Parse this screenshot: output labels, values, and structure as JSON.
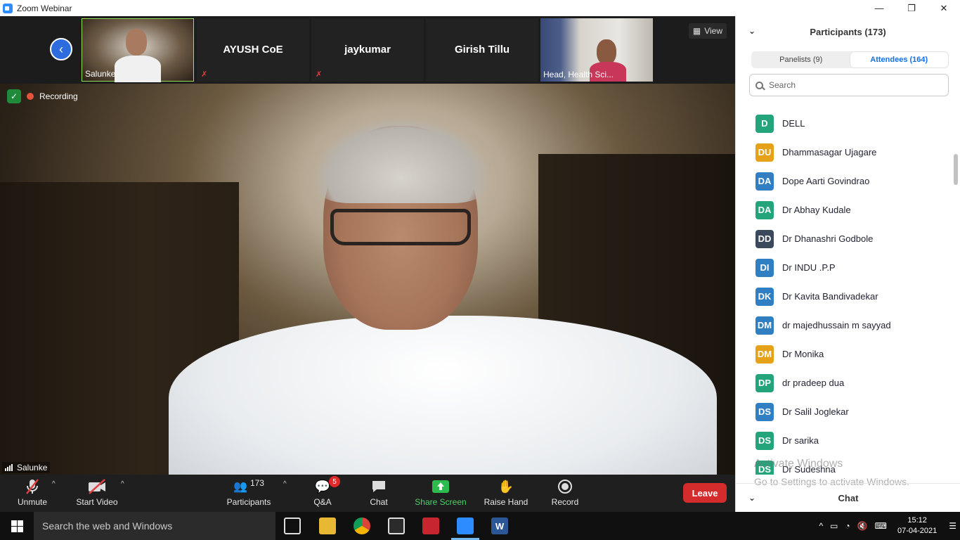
{
  "window": {
    "title": "Zoom Webinar",
    "controls": {
      "minimize": "—",
      "maximize": "❐",
      "close": "✕"
    }
  },
  "strip": {
    "back_icon": "chevron-left-icon",
    "tiles": [
      {
        "name": "Salunke",
        "type": "video",
        "active": true
      },
      {
        "name": "AYUSH CoE",
        "type": "name",
        "muted": true
      },
      {
        "name": "jaykumar",
        "type": "name",
        "muted": true
      },
      {
        "name": "Girish Tillu",
        "type": "name",
        "muted": false
      },
      {
        "name": "Head, Health Sci...",
        "type": "video",
        "active": false
      }
    ],
    "view_label": "View"
  },
  "main_video": {
    "recording_label": "Recording",
    "speaker_name": "Salunke"
  },
  "toolbar": {
    "unmute": "Unmute",
    "start_video": "Start Video",
    "participants": "Participants",
    "participants_count": "173",
    "qa": "Q&A",
    "qa_badge": "5",
    "chat": "Chat",
    "share_screen": "Share Screen",
    "raise_hand": "Raise Hand",
    "record": "Record",
    "leave": "Leave"
  },
  "panel": {
    "title": "Participants (173)",
    "tabs": {
      "panelists": "Panelists (9)",
      "attendees": "Attendees (164)"
    },
    "search_placeholder": "Search",
    "attendees": [
      {
        "initials": "D",
        "name": "DELL",
        "color": "#23a47a"
      },
      {
        "initials": "DU",
        "name": "Dhammasagar Ujagare",
        "color": "#e5a117"
      },
      {
        "initials": "DA",
        "name": "Dope Aarti Govindrao",
        "color": "#2f7fc2"
      },
      {
        "initials": "DA",
        "name": "Dr Abhay Kudale",
        "color": "#23a47a"
      },
      {
        "initials": "DD",
        "name": "Dr Dhanashri Godbole",
        "color": "#3a4a5c"
      },
      {
        "initials": "DI",
        "name": "Dr INDU .P.P",
        "color": "#2f7fc2"
      },
      {
        "initials": "DK",
        "name": "Dr Kavita Bandivadekar",
        "color": "#2f7fc2"
      },
      {
        "initials": "DM",
        "name": "dr majedhussain m sayyad",
        "color": "#2f7fc2"
      },
      {
        "initials": "DM",
        "name": "Dr Monika",
        "color": "#e5a117"
      },
      {
        "initials": "DP",
        "name": "dr pradeep dua",
        "color": "#23a47a"
      },
      {
        "initials": "DS",
        "name": "Dr Salil Joglekar",
        "color": "#2f7fc2"
      },
      {
        "initials": "DS",
        "name": "Dr sarika",
        "color": "#23a47a"
      },
      {
        "initials": "DS",
        "name": "Dr Sudeshna",
        "color": "#23a47a"
      }
    ],
    "watermark_title": "Activate Windows",
    "watermark_sub": "Go to Settings to activate Windows.",
    "chat_label": "Chat"
  },
  "taskbar": {
    "search_placeholder": "Search the web and Windows",
    "time": "15:12",
    "date": "07-04-2021"
  }
}
